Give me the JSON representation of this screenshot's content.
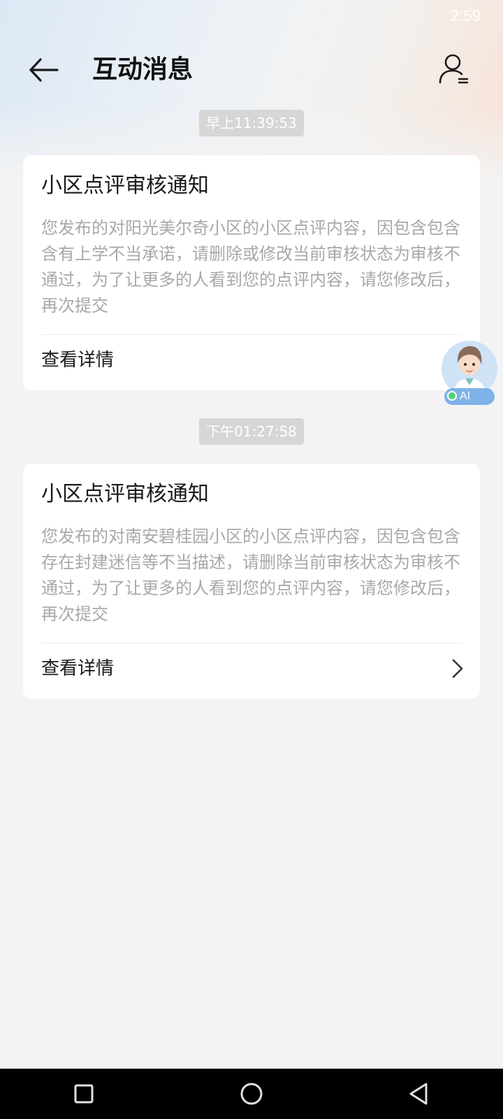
{
  "status_bar": {
    "time": "2:59"
  },
  "header": {
    "title": "互动消息",
    "back_icon": "arrow-left-icon",
    "profile_icon": "user-list-icon"
  },
  "messages": [
    {
      "timestamp": "早上11:39:53",
      "title": "小区点评审核通知",
      "body": "您发布的对阳光美尔奇小区的小区点评内容，因包含包含含有上学不当承诺，请删除或修改当前审核状态为审核不通过，为了让更多的人看到您的点评内容，请您修改后，再次提交",
      "action_label": "查看详情"
    },
    {
      "timestamp": "下午01:27:58",
      "title": "小区点评审核通知",
      "body": "您发布的对南安碧桂园小区的小区点评内容，因包含包含存在封建迷信等不当描述，请删除当前审核状态为审核不通过，为了让更多的人看到您的点评内容，请您修改后，再次提交",
      "action_label": "查看详情"
    }
  ],
  "ai_assistant": {
    "badge": "AI",
    "icon": "ai-avatar-icon"
  },
  "nav_bar": {
    "recents_icon": "square-icon",
    "home_icon": "circle-icon",
    "back_icon": "triangle-back-icon"
  },
  "colors": {
    "page_background": "#f3f3f3",
    "card_background": "#ffffff",
    "timestamp_chip": "#d6d6d6",
    "body_text": "#a8a8a8",
    "ai_badge": "#7fb2e8"
  }
}
